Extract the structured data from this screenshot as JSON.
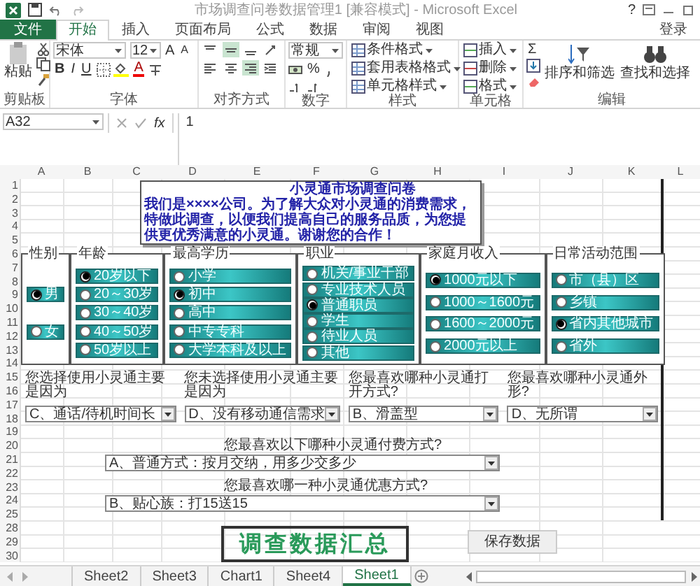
{
  "window": {
    "title": "市场调查问卷数据管理1 [兼容模式] - Microsoft Excel",
    "help": "?"
  },
  "ribbon_tabs": [
    {
      "label": "文件",
      "kind": "file",
      "selected": false
    },
    {
      "label": "开始",
      "kind": "tab",
      "selected": true
    },
    {
      "label": "插入",
      "kind": "tab",
      "selected": false
    },
    {
      "label": "页面布局",
      "kind": "tab",
      "selected": false
    },
    {
      "label": "公式",
      "kind": "tab",
      "selected": false
    },
    {
      "label": "数据",
      "kind": "tab",
      "selected": false
    },
    {
      "label": "审阅",
      "kind": "tab",
      "selected": false
    },
    {
      "label": "视图",
      "kind": "tab",
      "selected": false
    }
  ],
  "account": "登录",
  "clipboard": {
    "label": "剪贴板",
    "paste": "粘贴"
  },
  "font": {
    "label": "字体",
    "name": "宋体",
    "size": "12",
    "size_buttons": [
      "A",
      "A"
    ],
    "style_buttons": [
      "B",
      "I",
      "U"
    ],
    "color_button": "A"
  },
  "alignment": {
    "label": "对齐方式",
    "buttons": [
      {
        "selected": false
      },
      {
        "selected": true
      },
      {
        "selected": false
      },
      {
        "selected": false
      },
      {
        "selected": false
      },
      {
        "selected": true
      }
    ]
  },
  "number": {
    "label": "数字",
    "format": "常规",
    "percent": "%"
  },
  "styles": {
    "label": "样式",
    "items": [
      "条件格式",
      "套用表格格式",
      "单元格样式"
    ]
  },
  "cells": {
    "label": "单元格",
    "items": [
      "插入",
      "删除",
      "格式"
    ]
  },
  "editing": {
    "label": "编辑",
    "sum": "Σ",
    "items": [
      "排序和筛选",
      "查找和选择"
    ]
  },
  "formula_bar": {
    "name_box": "A32",
    "fx": "fx",
    "value": "1"
  },
  "sheet": {
    "columns": [
      "A",
      "B",
      "C",
      "D",
      "E",
      "F",
      "G",
      "H",
      "I",
      "J",
      "K",
      "L"
    ],
    "rows": [
      "1",
      "2",
      "3",
      "4",
      "5",
      "6",
      "7",
      "8",
      "9",
      "10",
      "11",
      "12",
      "13",
      "14",
      "15",
      "16",
      "17",
      "18",
      "19",
      "20",
      "21",
      "22",
      "23",
      "24",
      "25",
      "28",
      "29",
      "30"
    ],
    "survey_title": "小灵通市场调查问卷",
    "intro": "我们是××××公司。为了解大众对小灵通的消费需求，特做此调查，以便我们提高自己的服务品质，为您提供更优秀满意的小灵通。谢谢您的合作！",
    "groups": [
      {
        "title": "性别",
        "options": [
          {
            "label": "男",
            "selected": true
          },
          {
            "label": "女",
            "selected": false
          }
        ]
      },
      {
        "title": "年龄",
        "options": [
          {
            "label": "20岁以下",
            "selected": true
          },
          {
            "label": "20～30岁",
            "selected": false
          },
          {
            "label": "30～40岁",
            "selected": false
          },
          {
            "label": "40～50岁",
            "selected": false
          },
          {
            "label": "50岁以上",
            "selected": false
          }
        ]
      },
      {
        "title": "最高学历",
        "options": [
          {
            "label": "小学",
            "selected": false
          },
          {
            "label": "初中",
            "selected": true
          },
          {
            "label": "高中",
            "selected": false
          },
          {
            "label": "中专专科",
            "selected": false
          },
          {
            "label": "大学本科及以上",
            "selected": false
          }
        ]
      },
      {
        "title": "职业",
        "options": [
          {
            "label": "机关/事业干部",
            "selected": false
          },
          {
            "label": "专业技术人员",
            "selected": false
          },
          {
            "label": "普通职员",
            "selected": true
          },
          {
            "label": "学生",
            "selected": false
          },
          {
            "label": "待业人员",
            "selected": false
          },
          {
            "label": "其他",
            "selected": false
          }
        ]
      },
      {
        "title": "家庭月收入",
        "options": [
          {
            "label": "1000元以下",
            "selected": true
          },
          {
            "label": "1000～1600元",
            "selected": false
          },
          {
            "label": "1600～2000元",
            "selected": false
          },
          {
            "label": "2000元以上",
            "selected": false
          }
        ]
      },
      {
        "title": "日常活动范围",
        "options": [
          {
            "label": "市（县）区",
            "selected": false
          },
          {
            "label": "乡镇",
            "selected": false
          },
          {
            "label": "省内其他城市",
            "selected": true
          },
          {
            "label": "省外",
            "selected": false
          }
        ]
      }
    ],
    "questions": [
      {
        "prompt": "您选择使用小灵通主要是因为",
        "answer": "C、通话/待机时间长"
      },
      {
        "prompt": "您未选择使用小灵通主要是因为",
        "answer": "D、没有移动通信需求"
      },
      {
        "prompt": "您最喜欢哪种小灵通打开方式?",
        "answer": "B、滑盖型"
      },
      {
        "prompt": "您最喜欢哪种小灵通外形?",
        "answer": "D、无所谓"
      }
    ],
    "wide_questions": [
      {
        "prompt": "您最喜欢以下哪种小灵通付费方式?",
        "answer": "A、普通方式：按月交纳，用多少交多少"
      },
      {
        "prompt": "您最喜欢哪一种小灵通优惠方式?",
        "answer": "B、贴心族：打15送15"
      }
    ],
    "summary_title": "调查数据汇总",
    "save_button": "保存数据"
  },
  "sheet_tabs": [
    {
      "label": "Sheet2",
      "selected": false
    },
    {
      "label": "Sheet3",
      "selected": false
    },
    {
      "label": "Chart1",
      "selected": false
    },
    {
      "label": "Sheet4",
      "selected": false
    },
    {
      "label": "Sheet1",
      "selected": true
    }
  ]
}
